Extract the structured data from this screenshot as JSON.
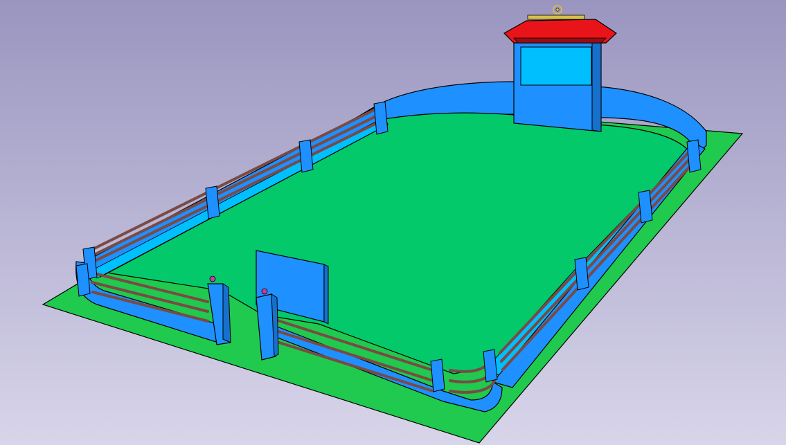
{
  "scene": {
    "description_visible_text": "",
    "colors": {
      "background_top": "#9a95bf",
      "background_bottom": "#d8d5ea",
      "ground": "#1fca4e",
      "ground_edge": "#0f7a2c",
      "court": "#03c96a",
      "wall": "#1e90ff",
      "wall_light": "#3aa8ff",
      "wall_dark": "#1670cc",
      "wall_inner": "#00bfff",
      "rail": "#7a4a44",
      "rail_highlight": "#b07a70",
      "roof": "#e8141a",
      "roof_dark": "#9a0c10",
      "ornament": "#d8c048",
      "finial": "#c040a0",
      "outline": "#000000"
    },
    "objects": [
      {
        "name": "ground-plate"
      },
      {
        "name": "court-floor"
      },
      {
        "name": "fence-wall"
      },
      {
        "name": "railings"
      },
      {
        "name": "pavilion-gate"
      },
      {
        "name": "entrance-gap"
      },
      {
        "name": "standalone-panel"
      },
      {
        "name": "gate-post-finials"
      }
    ]
  }
}
